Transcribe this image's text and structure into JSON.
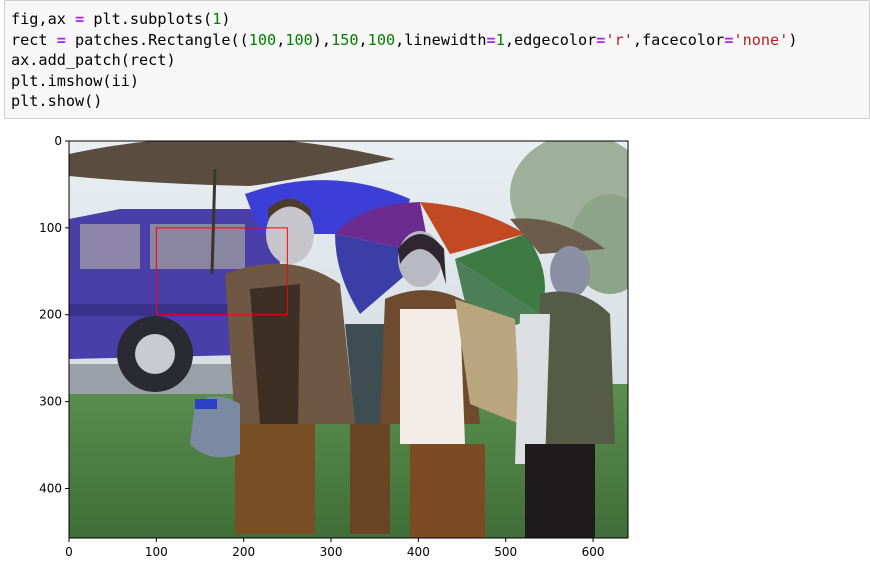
{
  "code_cell": {
    "lines": [
      {
        "segments": [
          {
            "t": "fig,ax ",
            "c": "plain"
          },
          {
            "t": "=",
            "c": "op"
          },
          {
            "t": " plt.subplots(",
            "c": "plain"
          },
          {
            "t": "1",
            "c": "num"
          },
          {
            "t": ")",
            "c": "plain"
          }
        ]
      },
      {
        "segments": [
          {
            "t": "rect ",
            "c": "plain"
          },
          {
            "t": "=",
            "c": "op"
          },
          {
            "t": " patches.Rectangle((",
            "c": "plain"
          },
          {
            "t": "100",
            "c": "num"
          },
          {
            "t": ",",
            "c": "plain"
          },
          {
            "t": "100",
            "c": "num"
          },
          {
            "t": "),",
            "c": "plain"
          },
          {
            "t": "150",
            "c": "num"
          },
          {
            "t": ",",
            "c": "plain"
          },
          {
            "t": "100",
            "c": "num"
          },
          {
            "t": ",linewidth",
            "c": "plain"
          },
          {
            "t": "=",
            "c": "op"
          },
          {
            "t": "1",
            "c": "num"
          },
          {
            "t": ",edgecolor",
            "c": "plain"
          },
          {
            "t": "=",
            "c": "op"
          },
          {
            "t": "'r'",
            "c": "str"
          },
          {
            "t": ",facecolor",
            "c": "plain"
          },
          {
            "t": "=",
            "c": "op"
          },
          {
            "t": "'none'",
            "c": "str"
          },
          {
            "t": ")",
            "c": "plain"
          }
        ]
      },
      {
        "segments": [
          {
            "t": "ax.add_patch(rect)",
            "c": "plain"
          }
        ]
      },
      {
        "segments": [
          {
            "t": "plt.imshow(ii)",
            "c": "plain"
          }
        ]
      },
      {
        "segments": [
          {
            "t": "plt.show()",
            "c": "plain"
          }
        ]
      }
    ]
  },
  "figure": {
    "image_extent": {
      "x": [
        0,
        640
      ],
      "y": [
        0,
        457
      ]
    },
    "x_ticks": [
      0,
      100,
      200,
      300,
      400,
      500,
      600
    ],
    "x_tick_labels": [
      "0",
      "100",
      "200",
      "300",
      "400",
      "500",
      "600"
    ],
    "y_ticks": [
      0,
      100,
      200,
      300,
      400
    ],
    "y_tick_labels": [
      "0",
      "100",
      "200",
      "300",
      "400"
    ],
    "rectangle": {
      "x": 100,
      "y": 100,
      "width": 150,
      "height": 100,
      "edgecolor": "#ff0000",
      "facecolor": "none"
    }
  },
  "colors": {
    "cell_background": "#f7f7f7",
    "cell_border": "#cfcfcf",
    "keyword_operator": "#aa22ff",
    "number": "#008000",
    "string": "#ba2121"
  }
}
